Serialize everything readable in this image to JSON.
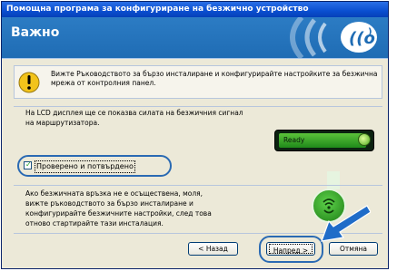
{
  "window": {
    "title": "Помощна програма за конфигуриране на безжично устройство"
  },
  "header": {
    "title": "Важно"
  },
  "warning": {
    "text": "Вижте Ръководството за бързо инсталиране и конфигурирайте настройките за безжична мрежа от контролния панел."
  },
  "lcd_info": {
    "text": "На LCD дисплея ще се показва силата на безжичния сигнал на маршрутизатора."
  },
  "lcd": {
    "screen_text": "Ready"
  },
  "confirm": {
    "label": "Проверено и потвърдено",
    "checked": true
  },
  "info": {
    "text": "Ако безжичната връзка не е осъществена, моля, вижте ръководството за бързо инсталиране и конфигурирайте безжичните настройки, след това отново стартирайте тази инсталация."
  },
  "buttons": {
    "back": "< Назад",
    "next": "Напред >",
    "cancel": "Отмяна"
  },
  "colors": {
    "title_bar": "#0a4fd0",
    "header": "#2c7cc4",
    "highlight": "#2a6ab3",
    "lcd_green": "#5bc23a"
  },
  "icons": [
    "wifi-logo-icon",
    "warning-icon",
    "lcd-led-icon",
    "wifi-button-icon",
    "pointer-arrow-icon"
  ]
}
